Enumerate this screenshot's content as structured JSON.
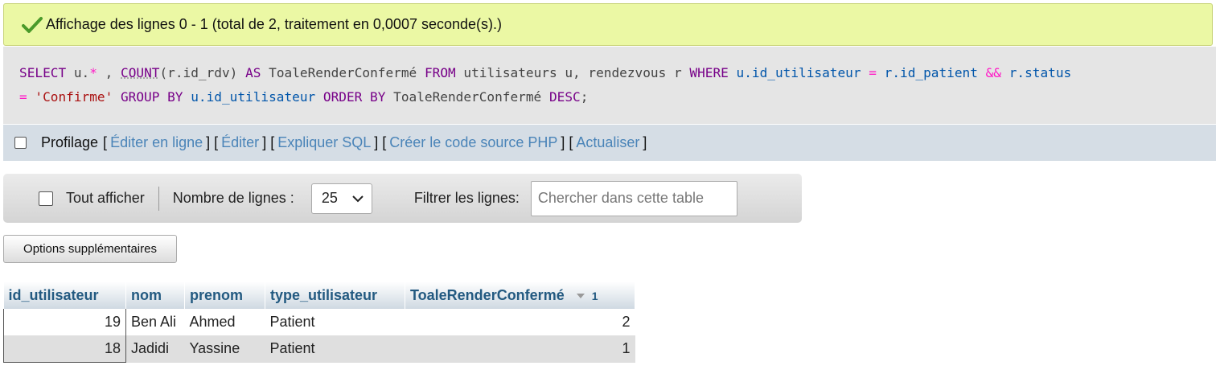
{
  "success": {
    "message": "Affichage des lignes 0 - 1 (total de 2, traitement en 0,0007 seconde(s).)"
  },
  "sql": {
    "tokens": [
      {
        "t": "SELECT",
        "c": "kw"
      },
      {
        "t": " u.",
        "c": "plain"
      },
      {
        "t": "*",
        "c": "op"
      },
      {
        "t": " , ",
        "c": "plain"
      },
      {
        "t": "COUNT",
        "c": "fn"
      },
      {
        "t": "(r.",
        "c": "plain"
      },
      {
        "t": "id_rdv",
        "c": "plain"
      },
      {
        "t": ")",
        "c": "plain"
      },
      {
        "t": " AS ",
        "c": "kw"
      },
      {
        "t": "ToaleRenderConfermé",
        "c": "plain"
      },
      {
        "t": " FROM ",
        "c": "kw"
      },
      {
        "t": "utilisateurs u, rendezvous r ",
        "c": "plain"
      },
      {
        "t": "WHERE ",
        "c": "kw"
      },
      {
        "t": "u.id_utilisateur",
        "c": "sym"
      },
      {
        "t": " = ",
        "c": "op"
      },
      {
        "t": "r.id_patient",
        "c": "sym"
      },
      {
        "t": " && ",
        "c": "op"
      },
      {
        "t": "r.status",
        "c": "sym"
      },
      {
        "t": "\n",
        "c": "br"
      },
      {
        "t": "= ",
        "c": "op"
      },
      {
        "t": "'Confirme'",
        "c": "str"
      },
      {
        "t": " GROUP BY ",
        "c": "kw"
      },
      {
        "t": "u.id_utilisateur",
        "c": "sym"
      },
      {
        "t": " ORDER BY ",
        "c": "kw"
      },
      {
        "t": "ToaleRenderConfermé",
        "c": "plain"
      },
      {
        "t": " DESC",
        "c": "kw"
      },
      {
        "t": ";",
        "c": "plain"
      }
    ]
  },
  "profiling": {
    "label": "Profilage",
    "links": [
      "Éditer en ligne",
      "Éditer",
      "Expliquer SQL",
      "Créer le code source PHP",
      "Actualiser"
    ]
  },
  "nav": {
    "show_all": "Tout afficher",
    "rows_label": "Nombre de lignes :",
    "rows_value": "25",
    "filter_label": "Filtrer les lignes:",
    "filter_placeholder": "Chercher dans cette table"
  },
  "options_button": "Options supplémentaires",
  "table": {
    "columns": [
      "id_utilisateur",
      "nom",
      "prenom",
      "type_utilisateur",
      "ToaleRenderConfermé"
    ],
    "sort_index": "1",
    "rows": [
      [
        "19",
        "Ben Ali",
        "Ahmed",
        "Patient",
        "2"
      ],
      [
        "18",
        "Jadidi",
        "Yassine",
        "Patient",
        "1"
      ]
    ]
  }
}
